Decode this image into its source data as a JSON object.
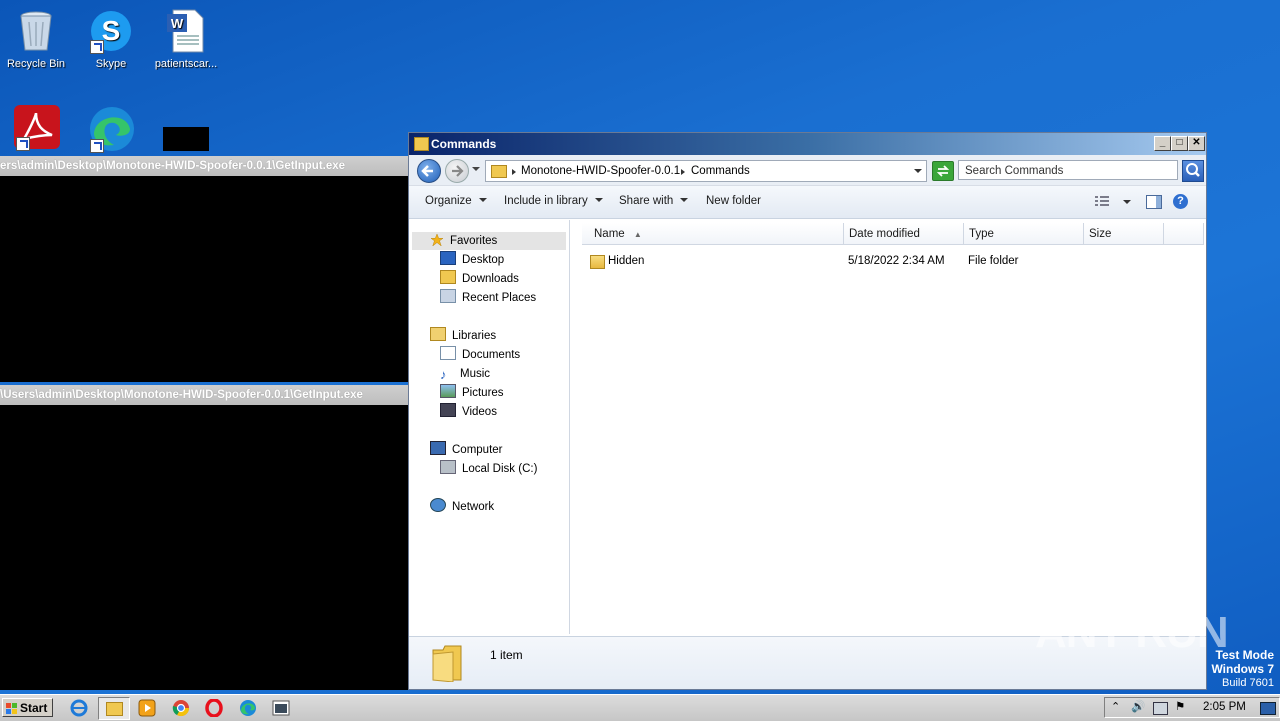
{
  "desktop": {
    "icons": [
      {
        "label": "Recycle Bin"
      },
      {
        "label": "Skype"
      },
      {
        "label": "patientscar..."
      }
    ]
  },
  "consoles": [
    {
      "title": "ers\\admin\\Desktop\\Monotone-HWID-Spoofer-0.0.1\\GetInput.exe"
    },
    {
      "title": "\\Users\\admin\\Desktop\\Monotone-HWID-Spoofer-0.0.1\\GetInput.exe"
    }
  ],
  "explorer": {
    "title": "Commands",
    "breadcrumb": [
      "Monotone-HWID-Spoofer-0.0.1",
      "Commands"
    ],
    "search_placeholder": "Search Commands",
    "toolbar": {
      "organize": "Organize",
      "include": "Include in library",
      "share": "Share with",
      "new_folder": "New folder"
    },
    "nav": {
      "favorites": "Favorites",
      "desktop": "Desktop",
      "downloads": "Downloads",
      "recent": "Recent Places",
      "libraries": "Libraries",
      "documents": "Documents",
      "music": "Music",
      "pictures": "Pictures",
      "videos": "Videos",
      "computer": "Computer",
      "local_disk": "Local Disk (C:)",
      "network": "Network"
    },
    "columns": {
      "name": "Name",
      "date": "Date modified",
      "type": "Type",
      "size": "Size"
    },
    "rows": [
      {
        "name": "Hidden",
        "date": "5/18/2022 2:34 AM",
        "type": "File folder",
        "size": ""
      }
    ],
    "status": "1 item"
  },
  "watermark": {
    "brand": "ANY RUN",
    "line1": "Test Mode",
    "line2": "Windows 7",
    "line3": "Build 7601"
  },
  "taskbar": {
    "start": "Start",
    "clock": "2:05 PM"
  }
}
